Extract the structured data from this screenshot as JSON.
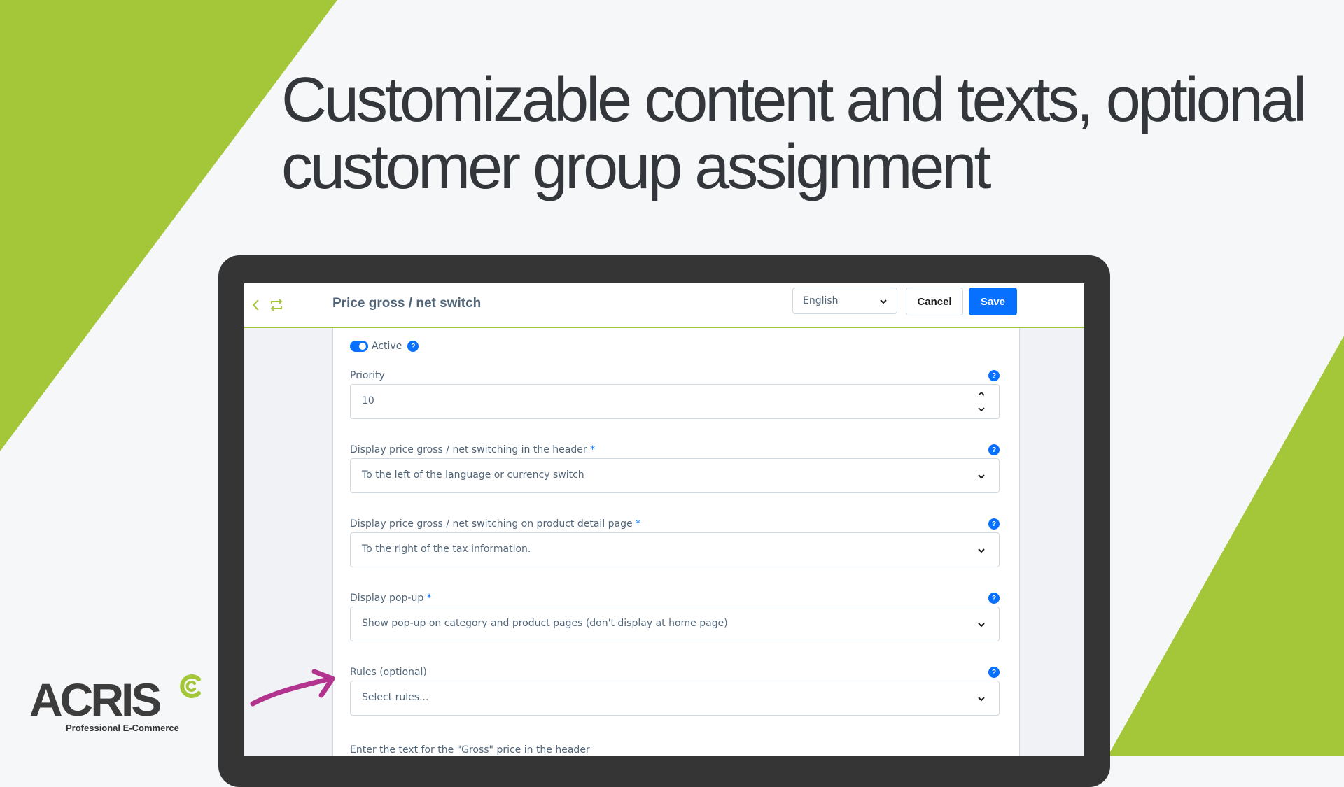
{
  "headline": {
    "line1": "Customizable content and texts, optional",
    "line2": "customer group assignment"
  },
  "colors": {
    "accent_green": "#a4c639",
    "primary_blue": "#0870ff",
    "arrow_magenta": "#b3348f",
    "device_frame": "#353535"
  },
  "app": {
    "title": "Price gross / net switch",
    "icons": [
      "back-chevron-icon",
      "rotate-icon"
    ],
    "language": {
      "selected": "English"
    },
    "cancel_label": "Cancel",
    "save_label": "Save"
  },
  "form": {
    "active": {
      "label": "Active",
      "checked": true
    },
    "help_glyph": "?",
    "required_mark": "*",
    "priority": {
      "label": "Priority",
      "value": "10"
    },
    "header_switch": {
      "label": "Display price gross / net switching in the header",
      "value": "To the left of the language or currency switch"
    },
    "detail_switch": {
      "label": "Display price gross / net switching on product detail page",
      "value": "To the right of the tax information."
    },
    "popup": {
      "label": "Display pop-up",
      "value": "Show pop-up on category and product pages (don't display at home page)"
    },
    "rules": {
      "label": "Rules (optional)",
      "placeholder": "Select rules..."
    },
    "gross_text_label": "Enter the text for the \"Gross\" price in the header"
  },
  "logo": {
    "wordmark": "ACRIS",
    "tagline": "Professional E-Commerce"
  }
}
